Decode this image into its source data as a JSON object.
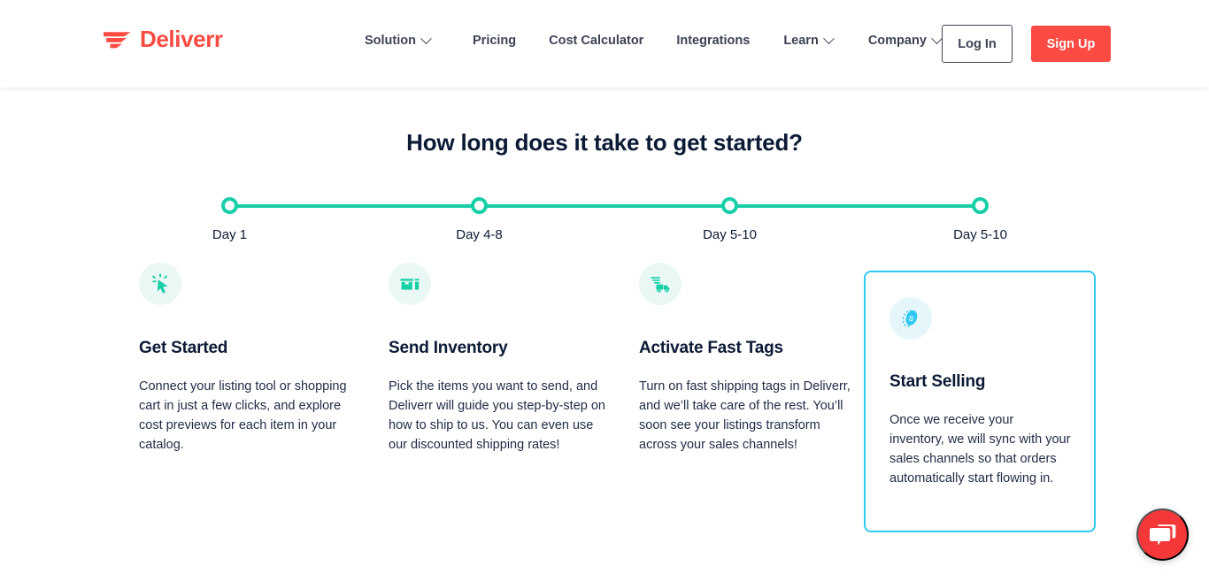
{
  "header": {
    "brand": {
      "name": "Deliverr",
      "logo_icon": "deliverr-wing-logo",
      "color": "#FB4B42"
    },
    "nav": [
      {
        "label": "Solution",
        "has_dropdown": true
      },
      {
        "label": "Pricing",
        "has_dropdown": false
      },
      {
        "label": "Cost Calculator",
        "has_dropdown": false
      },
      {
        "label": "Integrations",
        "has_dropdown": false
      },
      {
        "label": "Learn",
        "has_dropdown": true
      },
      {
        "label": "Company",
        "has_dropdown": true
      }
    ],
    "login_label": "Log In",
    "signup_label": "Sign Up"
  },
  "main": {
    "title": "How long does it take to get started?",
    "timeline": {
      "accent_color": "#17CFA7",
      "labels": [
        "Day 1",
        "Day 4-8",
        "Day 5-10",
        "Day 5-10"
      ]
    },
    "cards": [
      {
        "icon": "click-cursor-icon",
        "title": "Get Started",
        "text": "Connect your listing tool or shopping cart in just a few clicks, and explore cost previews for each item in your catalog."
      },
      {
        "icon": "open-box-icon",
        "title": "Send Inventory",
        "text": "Pick the items you want to send, and Deliverr will guide you step-by-step on how to ship to us. You can even use our discounted shipping rates!"
      },
      {
        "icon": "fast-delivery-truck-icon",
        "title": "Activate Fast Tags",
        "text": "Turn on fast shipping tags in Deliverr, and we’ll take care of the rest. You’ll soon see your listings transform across your sales channels!"
      },
      {
        "icon": "coin-dollar-icon",
        "title": "Start Selling",
        "text": "Once we receive your inventory, we will sync with your sales channels so that orders automatically start flowing in.",
        "highlighted": true,
        "highlight_color": "#2FC8F0"
      }
    ]
  },
  "chat": {
    "icon": "chat-bubbles-icon",
    "color": "#F4383A"
  }
}
